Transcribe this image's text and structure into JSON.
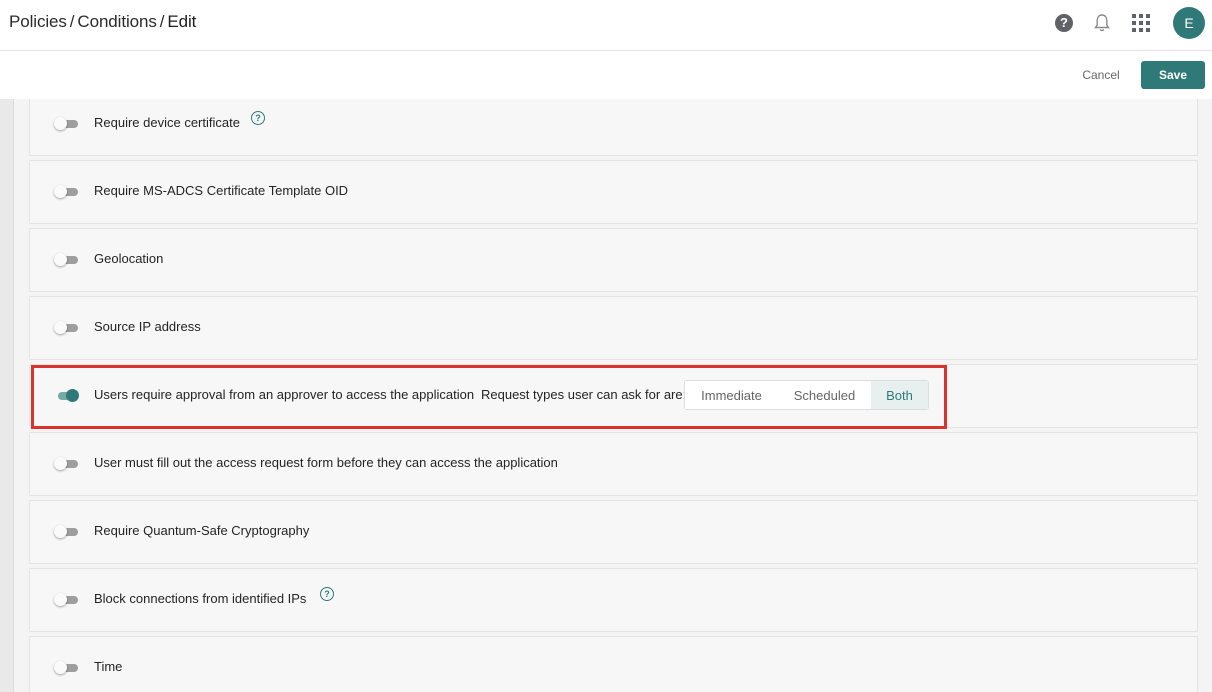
{
  "header": {
    "breadcrumb": [
      "Policies",
      "Conditions",
      "Edit"
    ],
    "separator": "/",
    "icons": [
      "help-icon",
      "bell-icon",
      "apps-grid-icon"
    ],
    "avatar_initial": "E"
  },
  "actions": {
    "cancel_label": "Cancel",
    "save_label": "Save"
  },
  "conditions": [
    {
      "label": "Require device certificate",
      "enabled": false,
      "info": true
    },
    {
      "label": "Require MS-ADCS Certificate Template OID",
      "enabled": false
    },
    {
      "label": "Geolocation",
      "enabled": false
    },
    {
      "label": "Source IP address",
      "enabled": false
    },
    {
      "label": "Users require approval from an approver to access the application",
      "enabled": true
    },
    {
      "label": "User must fill out the access request form before they can access the application",
      "enabled": false
    },
    {
      "label": "Require Quantum-Safe Cryptography",
      "enabled": false
    },
    {
      "label": "Block connections from identified IPs",
      "enabled": false,
      "info": true
    },
    {
      "label": "Time",
      "enabled": false
    }
  ],
  "approval": {
    "request_types_label": "Request types user can ask for are:",
    "options": [
      "Immediate",
      "Scheduled",
      "Both"
    ],
    "selected": "Both"
  },
  "colors": {
    "accent": "#2f7a78",
    "highlight": "#d9342b"
  }
}
